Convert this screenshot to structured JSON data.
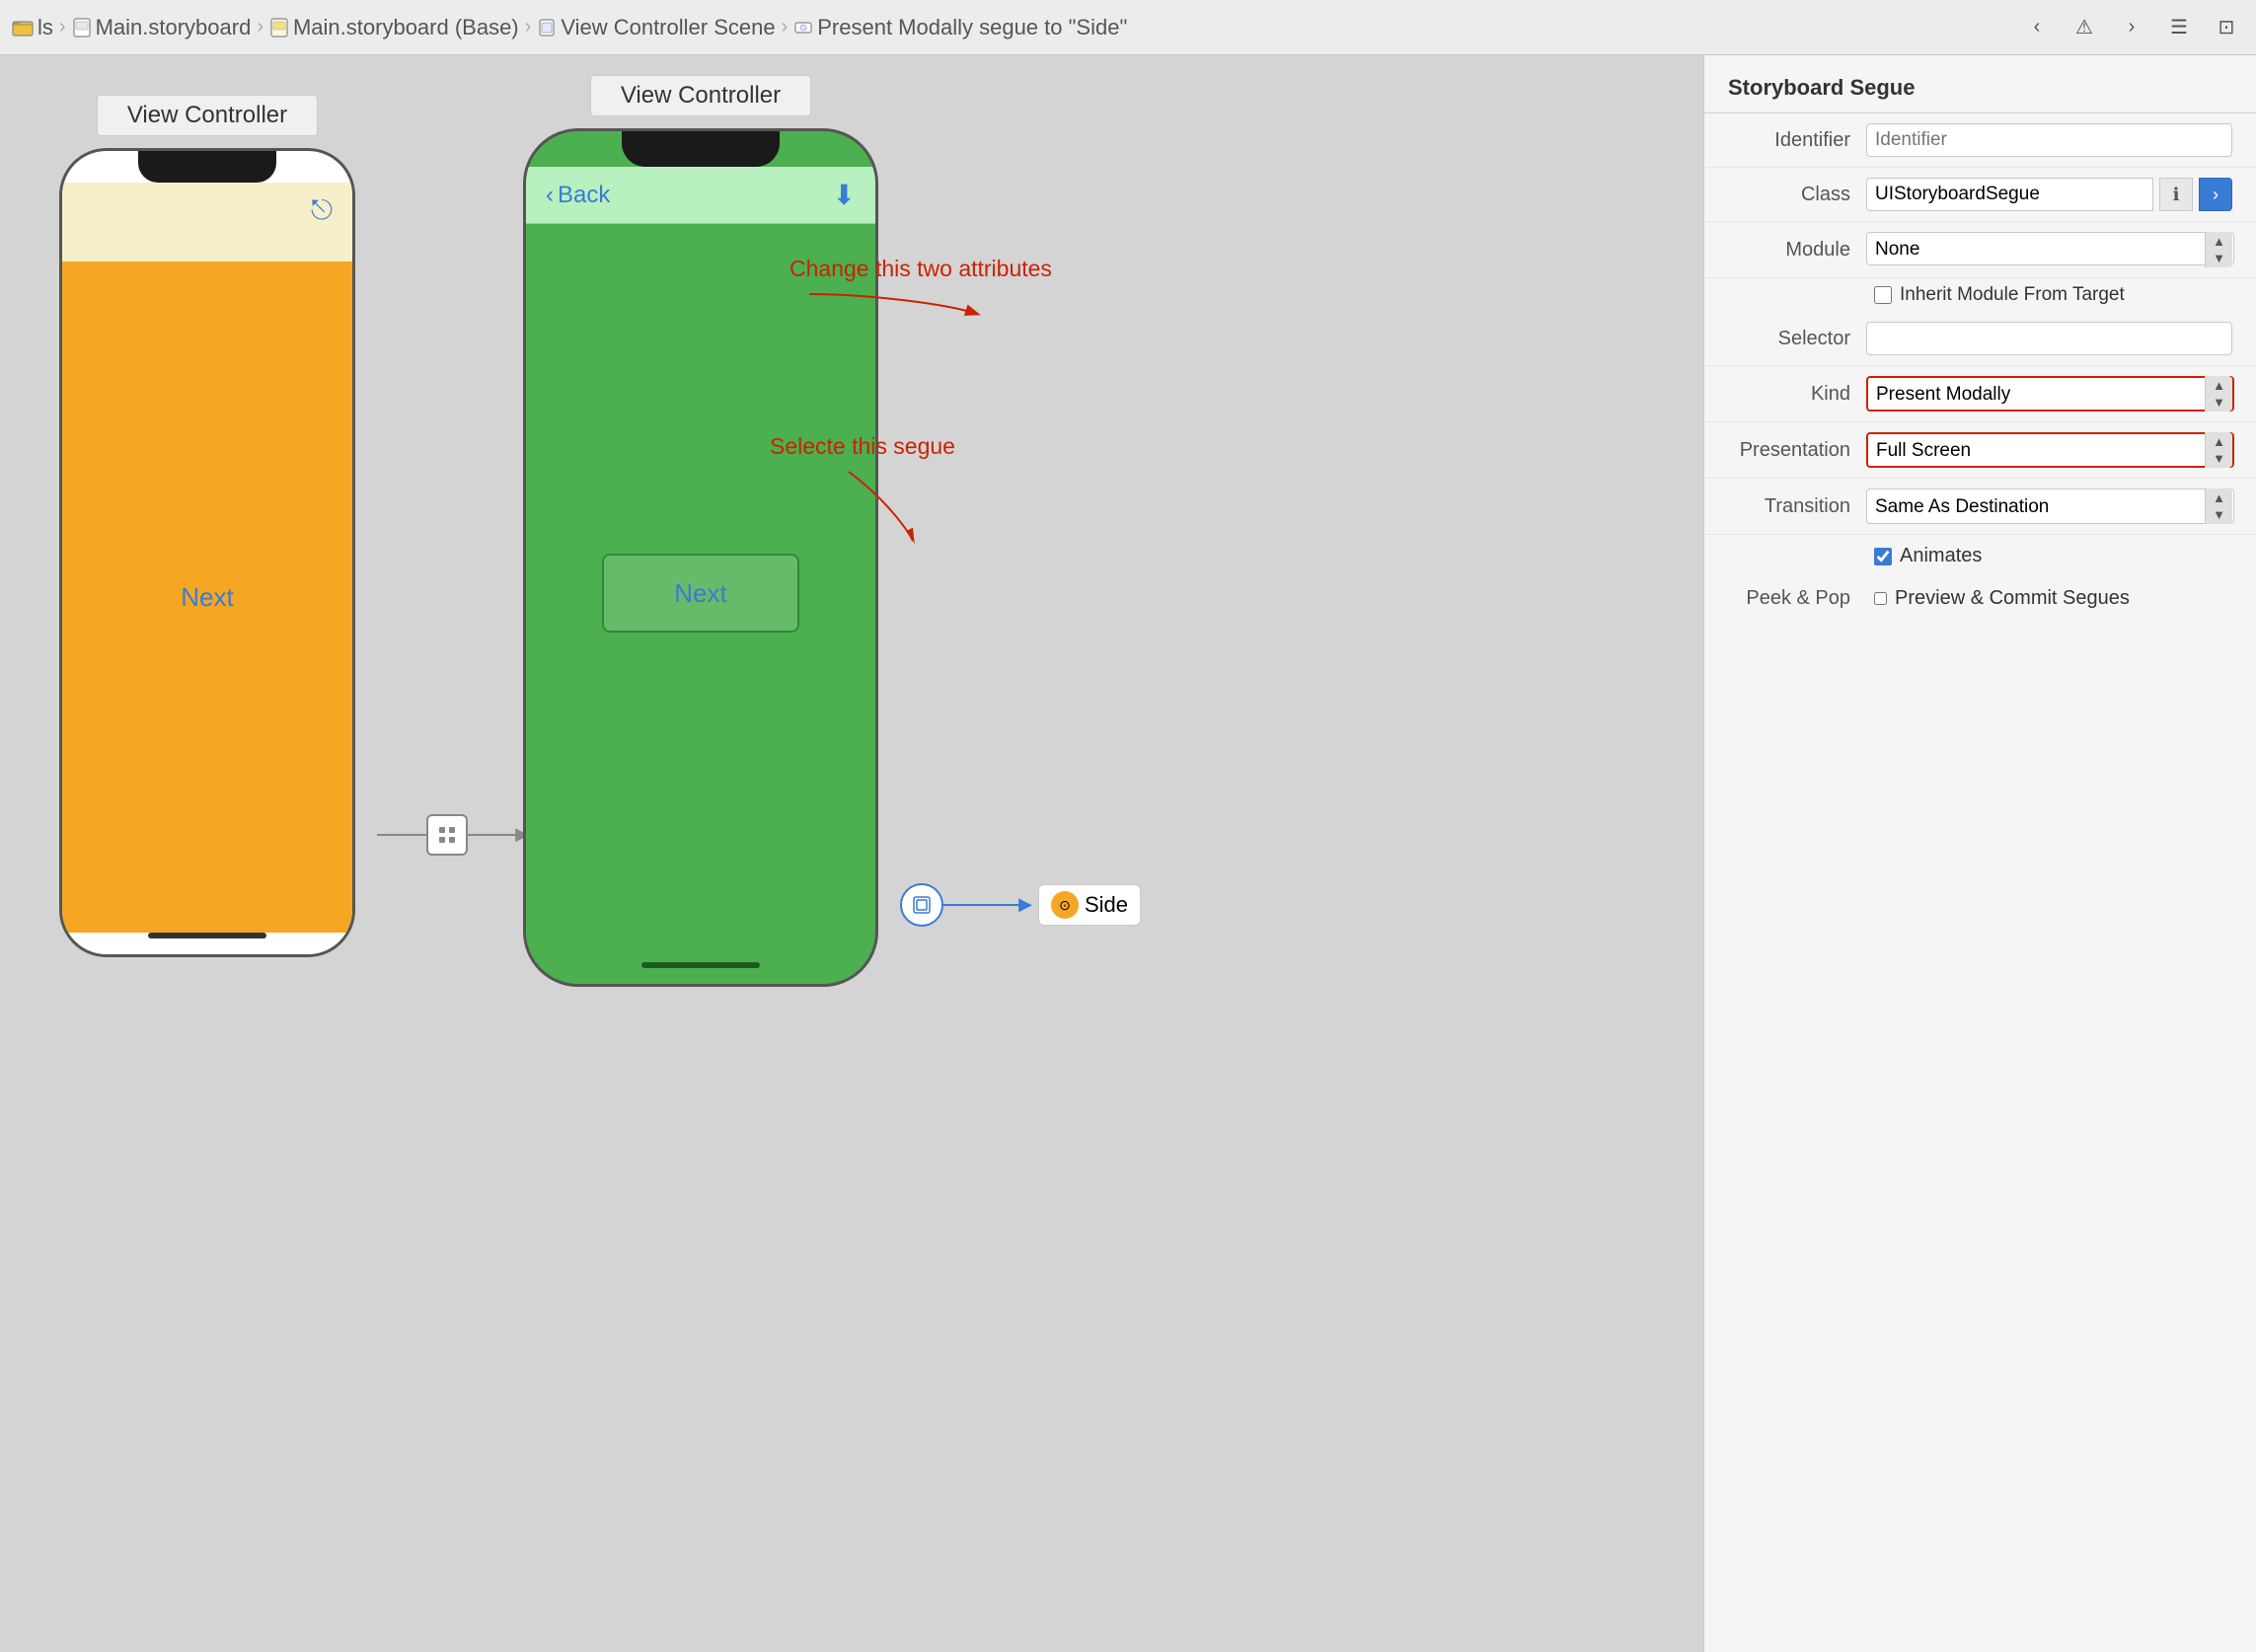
{
  "topbar": {
    "breadcrumb": [
      {
        "label": "ls",
        "icon": "folder"
      },
      {
        "label": "Main.storyboard",
        "icon": "storyboard"
      },
      {
        "label": "Main.storyboard (Base)",
        "icon": "storyboard"
      },
      {
        "label": "View Controller Scene",
        "icon": "scene"
      },
      {
        "label": "Present Modally segue to \"Side\"",
        "icon": "segue"
      }
    ],
    "buttons": [
      "back",
      "warning",
      "forward",
      "menu",
      "square"
    ]
  },
  "canvas": {
    "left_scene_label": "View Controller",
    "right_scene_label": "View Controller",
    "left_next_label": "Next",
    "right_next_label": "Next",
    "back_label": "Back",
    "side_label": "Side",
    "annotation_change": "Change this two\nattributes",
    "annotation_select": "Selecte this segue"
  },
  "panel": {
    "title": "Storyboard Segue",
    "identifier_label": "Identifier",
    "identifier_placeholder": "Identifier",
    "class_label": "Class",
    "class_value": "UIStoryboardSegue",
    "module_label": "Module",
    "module_value": "None",
    "inherit_label": "Inherit Module From Target",
    "selector_label": "Selector",
    "kind_label": "Kind",
    "kind_value": "Present Modally",
    "presentation_label": "Presentation",
    "presentation_value": "Full Screen",
    "transition_label": "Transition",
    "transition_value": "Same As Destination",
    "animates_label": "Animates",
    "peek_pop_label": "Peek & Pop",
    "preview_label": "Preview & Commit Segues"
  }
}
